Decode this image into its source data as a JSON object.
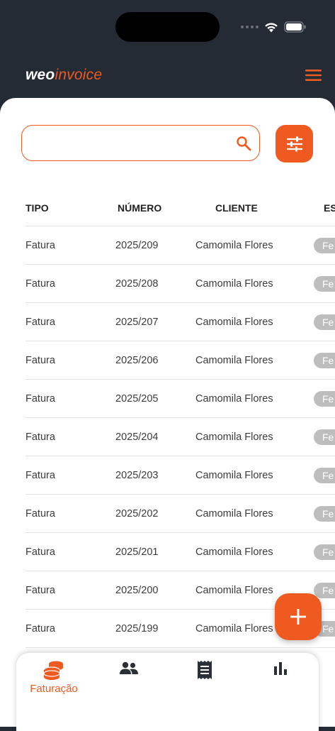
{
  "app": {
    "logo_part1": "weo",
    "logo_part2": "invoice"
  },
  "search": {
    "value": "",
    "placeholder": ""
  },
  "table": {
    "headers": {
      "tipo": "TIPO",
      "numero": "NÚMERO",
      "cliente": "CLIENTE",
      "estado": "ES"
    },
    "rows": [
      {
        "tipo": "Fatura",
        "numero": "2025/209",
        "cliente": "Camomila Flores",
        "estado": "Fe"
      },
      {
        "tipo": "Fatura",
        "numero": "2025/208",
        "cliente": "Camomila Flores",
        "estado": "Fe"
      },
      {
        "tipo": "Fatura",
        "numero": "2025/207",
        "cliente": "Camomila Flores",
        "estado": "Fe"
      },
      {
        "tipo": "Fatura",
        "numero": "2025/206",
        "cliente": "Camomila Flores",
        "estado": "Fe"
      },
      {
        "tipo": "Fatura",
        "numero": "2025/205",
        "cliente": "Camomila Flores",
        "estado": "Fe"
      },
      {
        "tipo": "Fatura",
        "numero": "2025/204",
        "cliente": "Camomila Flores",
        "estado": "Fe"
      },
      {
        "tipo": "Fatura",
        "numero": "2025/203",
        "cliente": "Camomila Flores",
        "estado": "Fe"
      },
      {
        "tipo": "Fatura",
        "numero": "2025/202",
        "cliente": "Camomila Flores",
        "estado": "Fe"
      },
      {
        "tipo": "Fatura",
        "numero": "2025/201",
        "cliente": "Camomila Flores",
        "estado": "Fe"
      },
      {
        "tipo": "Fatura",
        "numero": "2025/200",
        "cliente": "Camomila Flores",
        "estado": "Fe"
      },
      {
        "tipo": "Fatura",
        "numero": "2025/199",
        "cliente": "Camomila Flores",
        "estado": "Fe"
      }
    ]
  },
  "nav": {
    "faturacao_label": "Faturação",
    "items": [
      "coins-icon",
      "people-icon",
      "receipt-icon",
      "bar-chart-icon"
    ]
  },
  "colors": {
    "accent": "#ee5a1f",
    "header_bg": "#242b35",
    "status_pill": "#bdbdbd"
  }
}
